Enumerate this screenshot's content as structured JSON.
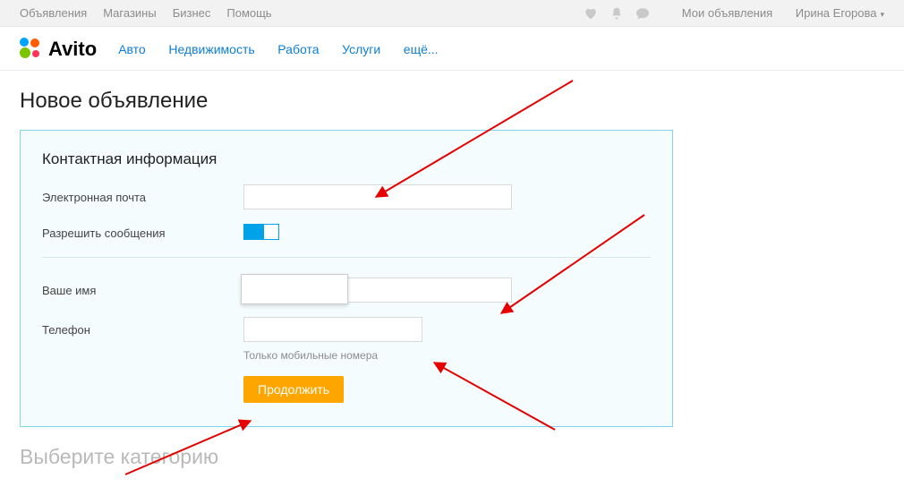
{
  "topbar": {
    "links": [
      "Объявления",
      "Магазины",
      "Бизнес",
      "Помощь"
    ],
    "my_ads": "Мои объявления",
    "user_name": "Ирина Егорова"
  },
  "header": {
    "logo_text": "Avito",
    "categories": [
      "Авто",
      "Недвижимость",
      "Работа",
      "Услуги",
      "ещё..."
    ]
  },
  "page": {
    "title": "Новое объявление"
  },
  "form": {
    "section_title": "Контактная информация",
    "email_label": "Электронная почта",
    "email_value": "",
    "allow_msg_label": "Разрешить сообщения",
    "name_label": "Ваше имя",
    "name_value": "",
    "phone_label": "Телефон",
    "phone_value": "",
    "phone_hint": "Только мобильные номера",
    "submit_label": "Продолжить"
  },
  "second_section": {
    "title": "Выберите категорию"
  }
}
